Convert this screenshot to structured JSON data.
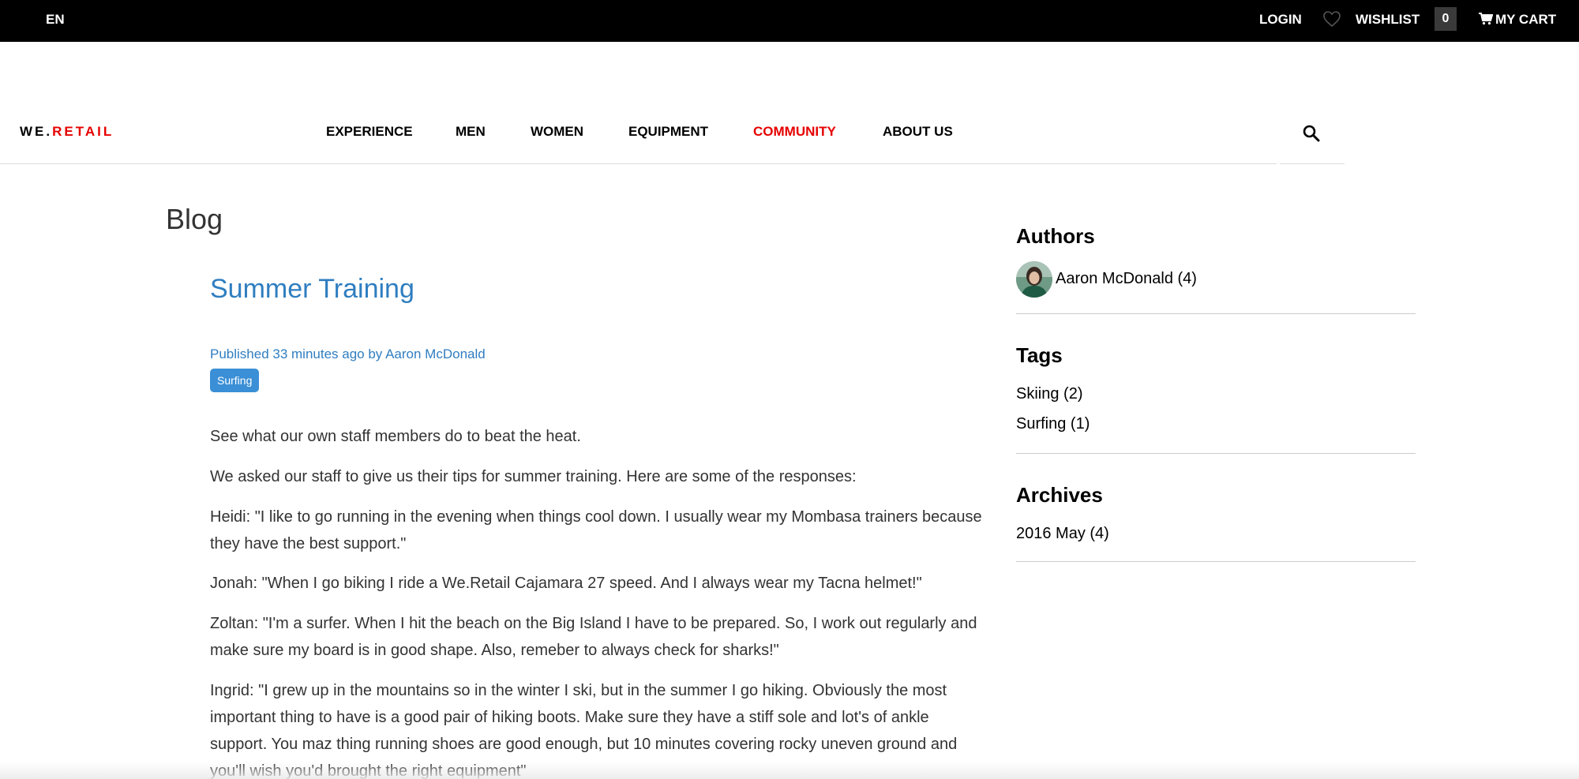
{
  "topbar": {
    "language": "EN",
    "login": "LOGIN",
    "wishlist": "WISHLIST",
    "wishlist_count": "0",
    "cart": "MY CART"
  },
  "header": {
    "logo_part1": "WE.",
    "logo_part2": "RETAIL",
    "nav": [
      "EXPERIENCE",
      "MEN",
      "WOMEN",
      "EQUIPMENT",
      "COMMUNITY",
      "ABOUT US"
    ],
    "active_nav": "COMMUNITY"
  },
  "blog": {
    "title": "Blog",
    "post_title": "Summer Training",
    "published": "Published 33 minutes ago by Aaron McDonald",
    "tag": "Surfing",
    "paragraphs": [
      "See what our own staff members do to beat the heat.",
      "We asked our staff to give us their tips for summer training. Here are some of the responses:",
      "Heidi: \"I like to go running in the evening when things cool down. I usually wear my Mombasa trainers because they have the best support.\"",
      "Jonah: \"When I go biking I ride a We.Retail Cajamara 27 speed. And I always wear my Tacna helmet!\"",
      "Zoltan: \"I'm a surfer. When I hit the beach on the Big Island I have to be prepared. So, I work out regularly and make sure my board is in good shape. Also, remeber to always check for sharks!\"",
      "Ingrid: \"I grew up in the mountains so in the winter I ski, but in the summer I go hiking. Obviously the most important thing to have is a good pair of hiking boots. Make sure they have a stiff sole and lot's of ankle support. You maz thing running shoes are good enough, but 10 minutes covering rocky uneven ground and you'll wish you'd brought the right equipment\""
    ]
  },
  "sidebar": {
    "authors_heading": "Authors",
    "author": "Aaron McDonald (4)",
    "tags_heading": "Tags",
    "tags": [
      "Skiing (2)",
      "Surfing (1)"
    ],
    "archives_heading": "Archives",
    "archive": "2016 May (4)"
  },
  "colors": {
    "accent_red": "#e60000",
    "link_blue": "#2f7ec0",
    "badge_blue": "#3a8fd6"
  }
}
